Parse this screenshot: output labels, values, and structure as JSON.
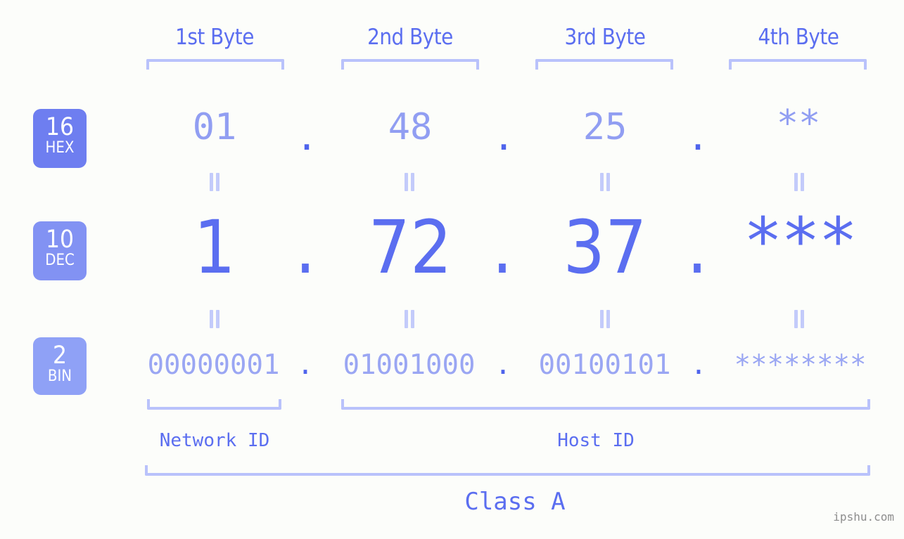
{
  "watermark": "ipshu.com",
  "colors": {
    "background": "#fcfdfa",
    "accent_strong": "#4f64ec",
    "accent": "#5b6ef0",
    "accent_light": "#919ef2",
    "bracket": "#b9c2fb",
    "badge_hex": "#6e7ef0",
    "badge_dec": "#8292f3",
    "badge_bin": "#8fa1f6",
    "watermark_gray": "#8d8d8d"
  },
  "byte_headers": [
    {
      "label": "1st Byte"
    },
    {
      "label": "2nd Byte"
    },
    {
      "label": "3rd Byte"
    },
    {
      "label": "4th Byte"
    }
  ],
  "bases": [
    {
      "number": "16",
      "abbr": "HEX"
    },
    {
      "number": "10",
      "abbr": "DEC"
    },
    {
      "number": "2",
      "abbr": "BIN"
    }
  ],
  "separator": ".",
  "rows": {
    "hex": {
      "base": "16",
      "abbr": "HEX",
      "values": [
        "01",
        "48",
        "25",
        "**"
      ]
    },
    "dec": {
      "base": "10",
      "abbr": "DEC",
      "values": [
        "1",
        "72",
        "37",
        "***"
      ]
    },
    "bin": {
      "base": "2",
      "abbr": "BIN",
      "values": [
        "00000001",
        "01001000",
        "00100101",
        "********"
      ]
    }
  },
  "segments": {
    "network_id": "Network ID",
    "host_id": "Host ID"
  },
  "class": "Class A",
  "chart_data": {
    "type": "table",
    "title": "Class A",
    "categories": [
      "1st Byte",
      "2nd Byte",
      "3rd Byte",
      "4th Byte"
    ],
    "series": [
      {
        "name": "HEX",
        "values": [
          "01",
          "48",
          "25",
          "**"
        ]
      },
      {
        "name": "DEC",
        "values": [
          "1",
          "72",
          "37",
          "***"
        ]
      },
      {
        "name": "BIN",
        "values": [
          "00000001",
          "01001000",
          "00100101",
          "********"
        ]
      }
    ],
    "annotations": [
      "Network ID",
      "Host ID",
      "Class A"
    ]
  }
}
